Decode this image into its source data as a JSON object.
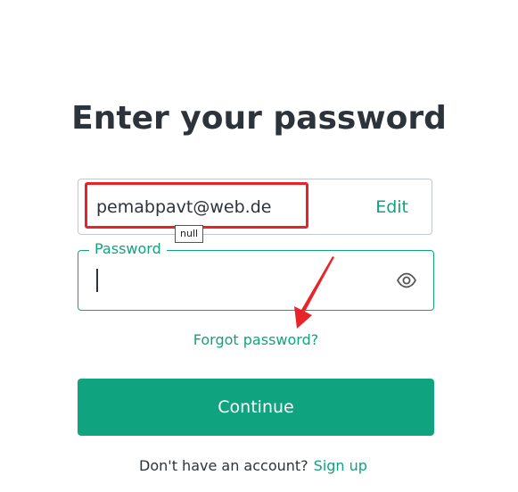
{
  "page": {
    "title": "Enter your password"
  },
  "email_field": {
    "value": "pemabpavt@web.de",
    "edit_label": "Edit",
    "tooltip": "null"
  },
  "password_field": {
    "label": "Password",
    "value": "",
    "toggle_icon": "eye-icon"
  },
  "links": {
    "forgot_password": "Forgot password?"
  },
  "actions": {
    "continue_label": "Continue"
  },
  "footer": {
    "prompt": "Don't have an account?",
    "signup_label": "Sign up"
  },
  "colors": {
    "accent": "#10a37f",
    "text": "#2d333a",
    "annotation": "#e8232a"
  }
}
